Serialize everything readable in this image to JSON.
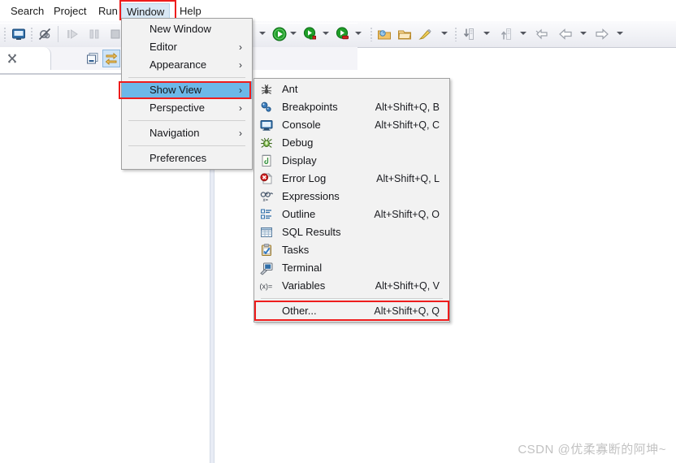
{
  "menubar": {
    "items": [
      {
        "label": "Search",
        "active": false
      },
      {
        "label": "Project",
        "active": false
      },
      {
        "label": "Run",
        "active": false
      },
      {
        "label": "Window",
        "active": true
      },
      {
        "label": "Help",
        "active": false
      }
    ]
  },
  "toolbar": {
    "icons": [
      {
        "name": "open-type-icon"
      },
      {
        "name": "skip-breakpoints-icon"
      },
      {
        "name": "resume-icon"
      },
      {
        "name": "suspend-icon"
      },
      {
        "name": "terminate-icon"
      },
      {
        "name": "debug-icon"
      },
      {
        "name": "run-icon"
      },
      {
        "name": "run-as-icon"
      },
      {
        "name": "coverage-icon"
      },
      {
        "name": "new-package-icon"
      },
      {
        "name": "new-folder-icon"
      },
      {
        "name": "external-tools-icon"
      },
      {
        "name": "next-annotation-icon"
      },
      {
        "name": "previous-annotation-icon"
      },
      {
        "name": "back-icon"
      },
      {
        "name": "last-edit-icon"
      },
      {
        "name": "forward-icon"
      }
    ]
  },
  "view_tab": {
    "close_icon": "close-view-icon",
    "minimize_icon": "minimize-view-icon",
    "link_icon": "link-with-editor-icon"
  },
  "window_menu": {
    "items": [
      {
        "label": "New Window",
        "submenu": false,
        "type": "item"
      },
      {
        "label": "Editor",
        "submenu": true,
        "type": "item"
      },
      {
        "label": "Appearance",
        "submenu": true,
        "type": "item"
      },
      {
        "type": "separator"
      },
      {
        "label": "Show View",
        "submenu": true,
        "type": "item",
        "selected": true
      },
      {
        "label": "Perspective",
        "submenu": true,
        "type": "item"
      },
      {
        "type": "separator"
      },
      {
        "label": "Navigation",
        "submenu": true,
        "type": "item"
      },
      {
        "type": "separator"
      },
      {
        "label": "Preferences",
        "submenu": false,
        "type": "item"
      }
    ]
  },
  "show_view_menu": {
    "items": [
      {
        "label": "Ant",
        "accel": "",
        "icon": "ant-icon"
      },
      {
        "label": "Breakpoints",
        "accel": "Alt+Shift+Q, B",
        "icon": "breakpoints-icon"
      },
      {
        "label": "Console",
        "accel": "Alt+Shift+Q, C",
        "icon": "console-icon"
      },
      {
        "label": "Debug",
        "accel": "",
        "icon": "debug-icon"
      },
      {
        "label": "Display",
        "accel": "",
        "icon": "display-icon"
      },
      {
        "label": "Error Log",
        "accel": "Alt+Shift+Q, L",
        "icon": "error-log-icon"
      },
      {
        "label": "Expressions",
        "accel": "",
        "icon": "expressions-icon"
      },
      {
        "label": "Outline",
        "accel": "Alt+Shift+Q, O",
        "icon": "outline-icon"
      },
      {
        "label": "SQL Results",
        "accel": "",
        "icon": "sql-results-icon"
      },
      {
        "label": "Tasks",
        "accel": "",
        "icon": "tasks-icon"
      },
      {
        "label": "Terminal",
        "accel": "",
        "icon": "terminal-icon"
      },
      {
        "label": "Variables",
        "accel": "Alt+Shift+Q, V",
        "icon": "variables-icon"
      },
      {
        "type": "separator"
      },
      {
        "label": "Other...",
        "accel": "Alt+Shift+Q, Q",
        "icon": "",
        "highlighted": true
      }
    ]
  },
  "watermark": {
    "text": "CSDN @优柔寡断的阿坤~"
  },
  "colors": {
    "menu_background": "#f2f2f2",
    "menu_border": "#a0a0a0",
    "selection_blue": "#6cb8e8",
    "highlight_red": "#ee1c1c",
    "menubar_active": "#d9e8f5",
    "toolbar_background": "#f1f2f6",
    "watermark_gray": "#c2c2c2"
  }
}
